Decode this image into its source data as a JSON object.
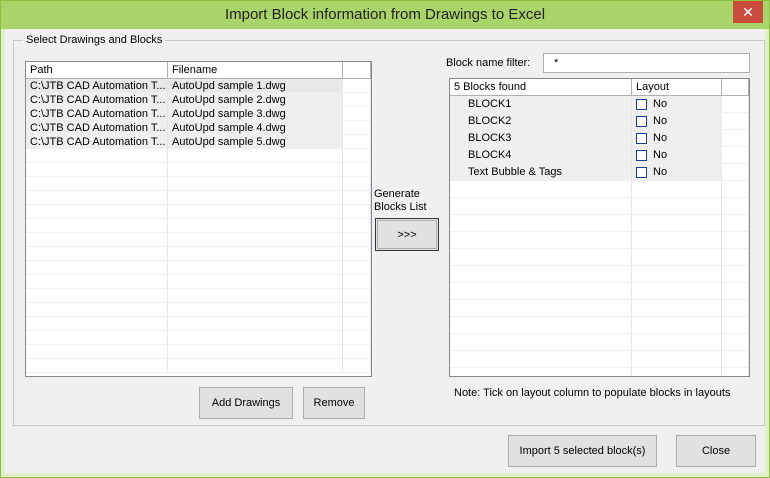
{
  "window": {
    "title": "Import Block information from Drawings to Excel",
    "close_glyph": "✕",
    "accent": "#a8d469"
  },
  "group": {
    "label": "Select Drawings and Blocks"
  },
  "drawings": {
    "columns": [
      "Path",
      "Filename"
    ],
    "rows": [
      {
        "path": "C:\\JTB CAD Automation T...",
        "filename": "AutoUpd sample 1.dwg"
      },
      {
        "path": "C:\\JTB CAD Automation T...",
        "filename": "AutoUpd sample 2.dwg"
      },
      {
        "path": "C:\\JTB CAD Automation T...",
        "filename": "AutoUpd sample 3.dwg"
      },
      {
        "path": "C:\\JTB CAD Automation T...",
        "filename": "AutoUpd sample 4.dwg"
      },
      {
        "path": "C:\\JTB CAD Automation T...",
        "filename": "AutoUpd sample 5.dwg"
      }
    ]
  },
  "generate": {
    "caption_line1": "Generate",
    "caption_line2": "Blocks List",
    "button_label": ">>>"
  },
  "filter": {
    "label": "Block name filter:",
    "value": "*"
  },
  "blocks": {
    "columns": [
      "5 Blocks found",
      "Layout"
    ],
    "rows": [
      {
        "name": "BLOCK1",
        "layout": "No"
      },
      {
        "name": "BLOCK2",
        "layout": "No"
      },
      {
        "name": "BLOCK3",
        "layout": "No"
      },
      {
        "name": "BLOCK4",
        "layout": "No"
      },
      {
        "name": "Text Bubble & Tags",
        "layout": "No"
      }
    ]
  },
  "buttons": {
    "add_drawings": "Add Drawings",
    "remove": "Remove",
    "import": "Import 5 selected block(s)",
    "close": "Close"
  },
  "note": "Note: Tick on layout column to populate blocks in layouts"
}
